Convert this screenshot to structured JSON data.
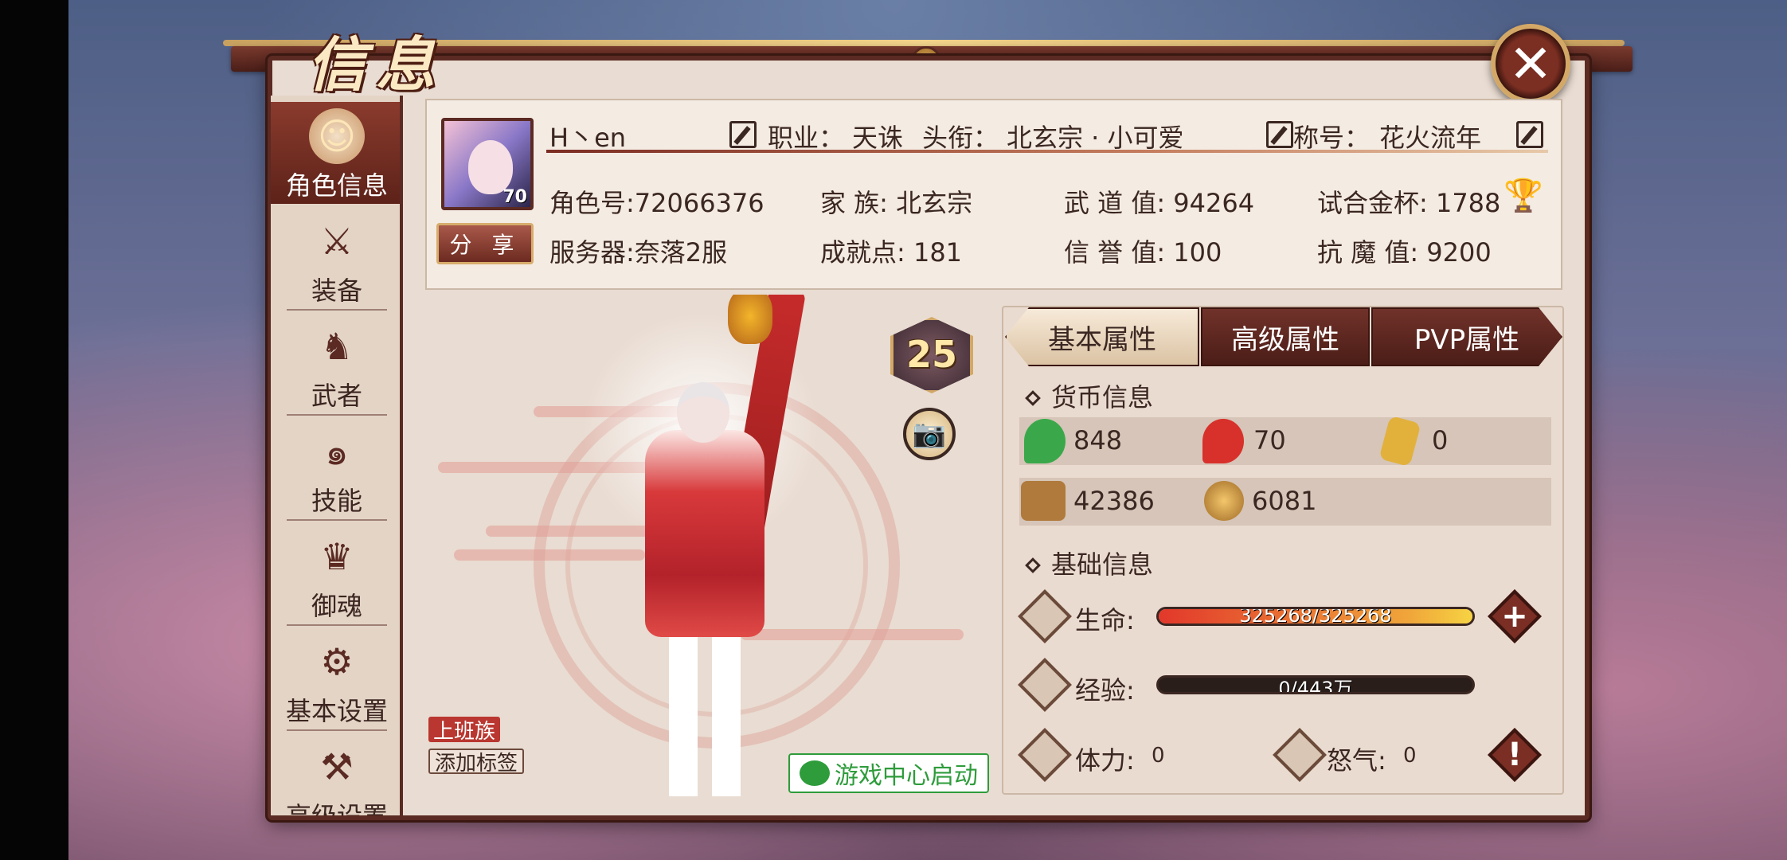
{
  "window": {
    "title": "信息",
    "close_label": "✕"
  },
  "sidebar": {
    "items": [
      {
        "label": "角色信息",
        "active": true
      },
      {
        "label": "装备"
      },
      {
        "label": "武者"
      },
      {
        "label": "技能"
      },
      {
        "label": "御魂"
      },
      {
        "label": "基本设置"
      },
      {
        "label": "高级设置"
      }
    ]
  },
  "profile": {
    "avatar_level": "70",
    "share_label": "分 享",
    "name": "H丶en",
    "class_label": "职业：",
    "class_value": "天诛",
    "title_label": "头衔：",
    "title_value": "北玄宗 · 小可爱",
    "nickname_label": "称号：",
    "nickname_value": "花火流年",
    "role_id": "角色号:72066376",
    "family": "家    族: 北玄宗",
    "martial": "武 道 值: 94264",
    "cup": "试合金杯: 1788",
    "server": "服务器:奈落2服",
    "achievement": "成就点: 181",
    "honor": "信 誉 值: 100",
    "resist": "抗 魔 值: 9200"
  },
  "character": {
    "level": "25",
    "tags": {
      "badge": "上班族",
      "add_label": "添加标签"
    },
    "wechat_label": "游戏中心启动"
  },
  "tabs": [
    {
      "label": "基本属性",
      "active": true
    },
    {
      "label": "高级属性"
    },
    {
      "label": "PVP属性"
    }
  ],
  "currency": {
    "title": "货币信息",
    "row1": [
      {
        "icon": "green-magatama-icon",
        "value": "848",
        "color": "#3aa84a"
      },
      {
        "icon": "red-magatama-icon",
        "value": "70",
        "color": "#d8302a"
      },
      {
        "icon": "gold-bar-icon",
        "value": "0",
        "color": "#e2b13c"
      }
    ],
    "row2": [
      {
        "icon": "treasure-chest-icon",
        "value": "42386",
        "color": "#b07a3c"
      },
      {
        "icon": "gold-coin-icon",
        "value": "6081",
        "color": "#d4a03a"
      }
    ]
  },
  "basic": {
    "title": "基础信息",
    "hp_label": "生命:",
    "hp_text": "325268/325268",
    "hp_fraction": 1.0,
    "exp_label": "经验:",
    "exp_text": "0/443万",
    "exp_fraction": 0.0,
    "stamina_label": "体力:",
    "stamina_value": "0",
    "rage_label": "怒气:",
    "rage_value": "0"
  }
}
